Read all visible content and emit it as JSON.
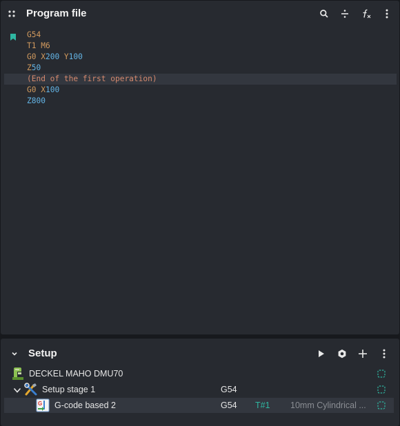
{
  "program_panel": {
    "title": "Program file",
    "icons": [
      "drag-handle-icon",
      "search-icon",
      "divide-icon",
      "function-icon",
      "more-icon"
    ],
    "lines": [
      [
        {
          "t": "G54",
          "c": "g"
        }
      ],
      [
        {
          "t": "T1 M6",
          "c": "g"
        }
      ],
      [
        {
          "t": "G0 ",
          "c": "g"
        },
        {
          "t": "X",
          "c": "g"
        },
        {
          "t": "200",
          "c": "num"
        },
        {
          "t": " Y",
          "c": "g"
        },
        {
          "t": "100",
          "c": "num"
        }
      ],
      [
        {
          "t": "Z",
          "c": "g"
        },
        {
          "t": "50",
          "c": "num"
        }
      ],
      [
        {
          "t": "(End of the first operation)",
          "c": "comment"
        }
      ],
      [
        {
          "t": "G0 ",
          "c": "g"
        },
        {
          "t": "X",
          "c": "g"
        },
        {
          "t": "100",
          "c": "num"
        }
      ],
      [
        {
          "t": "Z",
          "c": "num"
        },
        {
          "t": "800",
          "c": "num"
        }
      ]
    ],
    "active_line": 4
  },
  "setup_panel": {
    "title": "Setup",
    "icons": [
      "collapse-chevron-icon",
      "play-icon",
      "settings-icon",
      "add-icon",
      "more-icon"
    ],
    "machine": {
      "label": "DECKEL MAHO DMU70"
    },
    "stage": {
      "label": "Setup stage 1",
      "wcs": "G54"
    },
    "operation": {
      "label": "G-code based 2",
      "wcs": "G54",
      "tool_number": "T#1",
      "tool_desc": "10mm Cylindrical ..."
    }
  },
  "colors": {
    "background": "#17191d",
    "panel": "#272a30",
    "selected_row": "#33373f",
    "gcode": "#d19a5e",
    "number": "#64b5e6",
    "comment": "#d68a6e",
    "accent": "#2fb7a2"
  }
}
